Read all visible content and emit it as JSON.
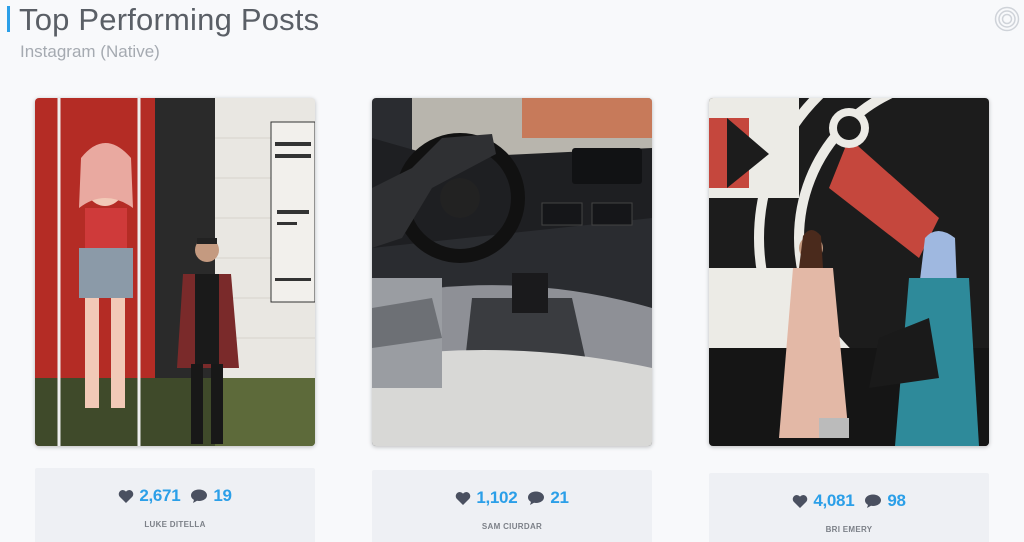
{
  "header": {
    "title": "Top Performing Posts",
    "subtitle": "Instagram (Native)",
    "accent_color": "#2b9fe8",
    "menu_icon": "target-icon"
  },
  "posts": [
    {
      "image": "mural-man-posing-photo",
      "likes": "2,671",
      "comments": "19",
      "author": "LUKE DITELLA"
    },
    {
      "image": "car-interior-steering-wheel-photo",
      "likes": "1,102",
      "comments": "21",
      "author": "SAM CIURDAR"
    },
    {
      "image": "two-women-mural-photo",
      "likes": "4,081",
      "comments": "98",
      "author": "BRI EMERY"
    }
  ],
  "icons": {
    "likes": "heart-icon",
    "comments": "speech-bubble-icon"
  },
  "colors": {
    "stat_blue": "#2b9fe8",
    "icon_dark": "#4a5060"
  }
}
